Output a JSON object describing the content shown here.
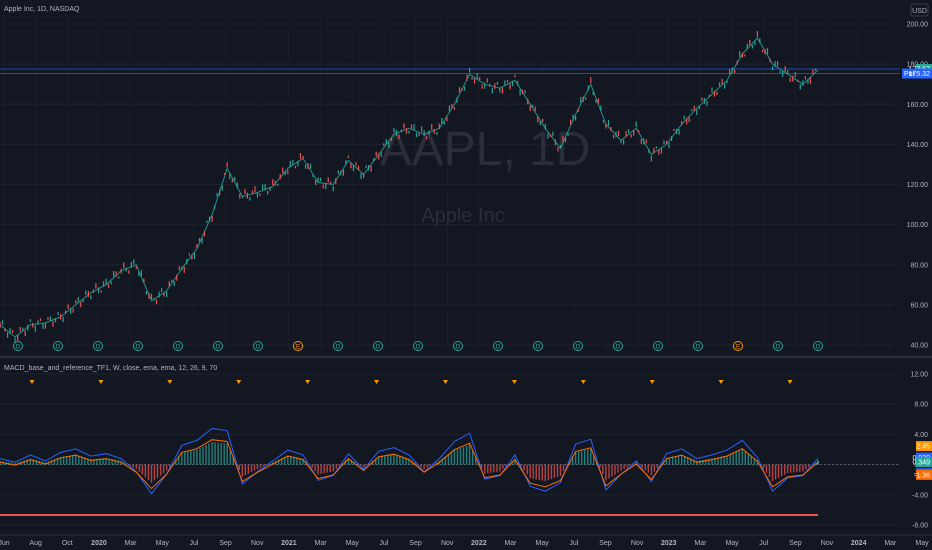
{
  "header": {
    "symbol_line": "Apple Inc, 1D, NASDAQ",
    "currency_button": "USD"
  },
  "watermark": {
    "symbol": "AAPL, 1D",
    "name": "Apple Inc"
  },
  "indicator": {
    "title": "MACD_base_and_reference_TF1, W, close, ema, ema, 12, 26, 9, 70"
  },
  "price_tags": [
    {
      "label": "",
      "value": "177.57",
      "color": "#26a69a"
    },
    {
      "label": "Pot",
      "value": "175.32",
      "color": "#2962ff"
    }
  ],
  "macd_tags": [
    {
      "value": "2.45",
      "color": "#ff9800"
    },
    {
      "value": "0.930",
      "color": "#2962ff"
    },
    {
      "value": "0.349",
      "color": "#26a69a"
    },
    {
      "value": "-1.14",
      "color": "#2962ff"
    },
    {
      "value": "-1.36",
      "color": "#ff6d00"
    }
  ],
  "events": {
    "labels": [
      "D",
      "D",
      "D",
      "D",
      "D",
      "D",
      "D",
      "E",
      "D",
      "D",
      "D",
      "D",
      "D",
      "D",
      "D",
      "D",
      "D",
      "D",
      "E",
      "D",
      "D"
    ],
    "special": "E"
  },
  "chart_data": [
    {
      "type": "line",
      "name": "price",
      "ylim": [
        40,
        200
      ],
      "yticks": [
        "200.00",
        "180.00",
        "160.00",
        "140.00",
        "120.00",
        "100.00",
        "80.00",
        "60.00",
        "40.00"
      ],
      "xticks": [
        "Jun",
        "Aug",
        "Oct",
        "2020",
        "Mar",
        "May",
        "Jul",
        "Sep",
        "Nov",
        "2021",
        "Mar",
        "May",
        "Jul",
        "Sep",
        "Nov",
        "2022",
        "Mar",
        "May",
        "Jul",
        "Sep",
        "Nov",
        "2023",
        "Mar",
        "May",
        "Jul",
        "Sep",
        "Nov",
        "2024",
        "Mar",
        "May"
      ],
      "x": [
        "2019-05",
        "2019-06",
        "2019-07",
        "2019-08",
        "2019-09",
        "2019-10",
        "2019-11",
        "2019-12",
        "2020-01",
        "2020-02",
        "2020-03",
        "2020-04",
        "2020-05",
        "2020-06",
        "2020-07",
        "2020-08",
        "2020-09",
        "2020-10",
        "2020-11",
        "2020-12",
        "2021-01",
        "2021-02",
        "2021-03",
        "2021-04",
        "2021-05",
        "2021-06",
        "2021-07",
        "2021-08",
        "2021-09",
        "2021-10",
        "2021-11",
        "2021-12",
        "2022-01",
        "2022-02",
        "2022-03",
        "2022-04",
        "2022-05",
        "2022-06",
        "2022-07",
        "2022-08",
        "2022-09",
        "2022-10",
        "2022-11",
        "2022-12",
        "2023-01",
        "2023-02",
        "2023-03",
        "2023-04",
        "2023-05",
        "2023-06",
        "2023-07",
        "2023-08",
        "2023-09",
        "2023-10",
        "2023-11"
      ],
      "values": [
        50,
        44,
        50,
        51,
        54,
        60,
        66,
        70,
        77,
        80,
        62,
        67,
        78,
        88,
        105,
        128,
        114,
        116,
        119,
        128,
        133,
        121,
        120,
        132,
        125,
        135,
        145,
        148,
        145,
        148,
        160,
        175,
        170,
        168,
        172,
        160,
        148,
        138,
        155,
        170,
        150,
        142,
        148,
        135,
        140,
        150,
        158,
        165,
        172,
        185,
        193,
        180,
        175,
        170,
        177
      ],
      "horizontal_lines": [
        177.57,
        175.32
      ]
    },
    {
      "type": "line",
      "name": "MACD",
      "ylim": [
        -8,
        12
      ],
      "yticks": [
        "12.00",
        "8.00",
        "4.00",
        "0.00",
        "-4.00",
        "-8.00"
      ],
      "series": [],
      "values_histogram": [
        0.5,
        0.2,
        0.8,
        0.3,
        1.0,
        1.3,
        0.7,
        0.9,
        0.5,
        -0.6,
        -2.4,
        -0.8,
        1.6,
        2.0,
        3.0,
        2.8,
        -1.6,
        -0.6,
        0.3,
        1.2,
        0.8,
        -1.3,
        -0.9,
        0.9,
        -0.4,
        1.1,
        1.4,
        0.8,
        -0.6,
        0.5,
        1.9,
        2.6,
        -1.2,
        -0.9,
        0.8,
        -1.8,
        -2.2,
        -1.5,
        1.7,
        2.1,
        -2.1,
        -0.8,
        0.3,
        -1.4,
        0.9,
        1.3,
        0.5,
        0.8,
        1.2,
        2.0,
        0.6,
        -2.2,
        -1.1,
        -0.9,
        0.5
      ],
      "signal_markers": 12
    }
  ]
}
